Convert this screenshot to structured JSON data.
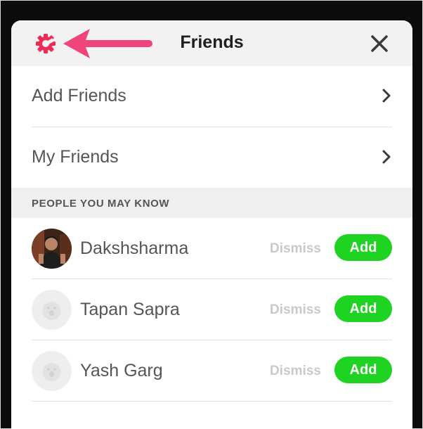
{
  "header": {
    "title": "Friends",
    "settings_icon": "gear-icon",
    "close_icon": "close-icon",
    "annotation_arrow_color": "#f0457a",
    "accent_color": "#ee2b55"
  },
  "menu": [
    {
      "label": "Add Friends",
      "icon": "chevron-right-icon"
    },
    {
      "label": "My Friends",
      "icon": "chevron-right-icon"
    }
  ],
  "section": {
    "label": "PEOPLE YOU MAY KNOW"
  },
  "people": [
    {
      "name": "Dakshsharma",
      "avatar": "photo",
      "dismiss_label": "Dismiss",
      "add_label": "Add"
    },
    {
      "name": "Tapan Sapra",
      "avatar": "placeholder-ghost",
      "dismiss_label": "Dismiss",
      "add_label": "Add"
    },
    {
      "name": "Yash Garg",
      "avatar": "placeholder-ghost",
      "dismiss_label": "Dismiss",
      "add_label": "Add"
    }
  ],
  "colors": {
    "add_button": "#1ed321",
    "dismiss_text": "#c9c9c9",
    "section_background": "#efefef"
  }
}
